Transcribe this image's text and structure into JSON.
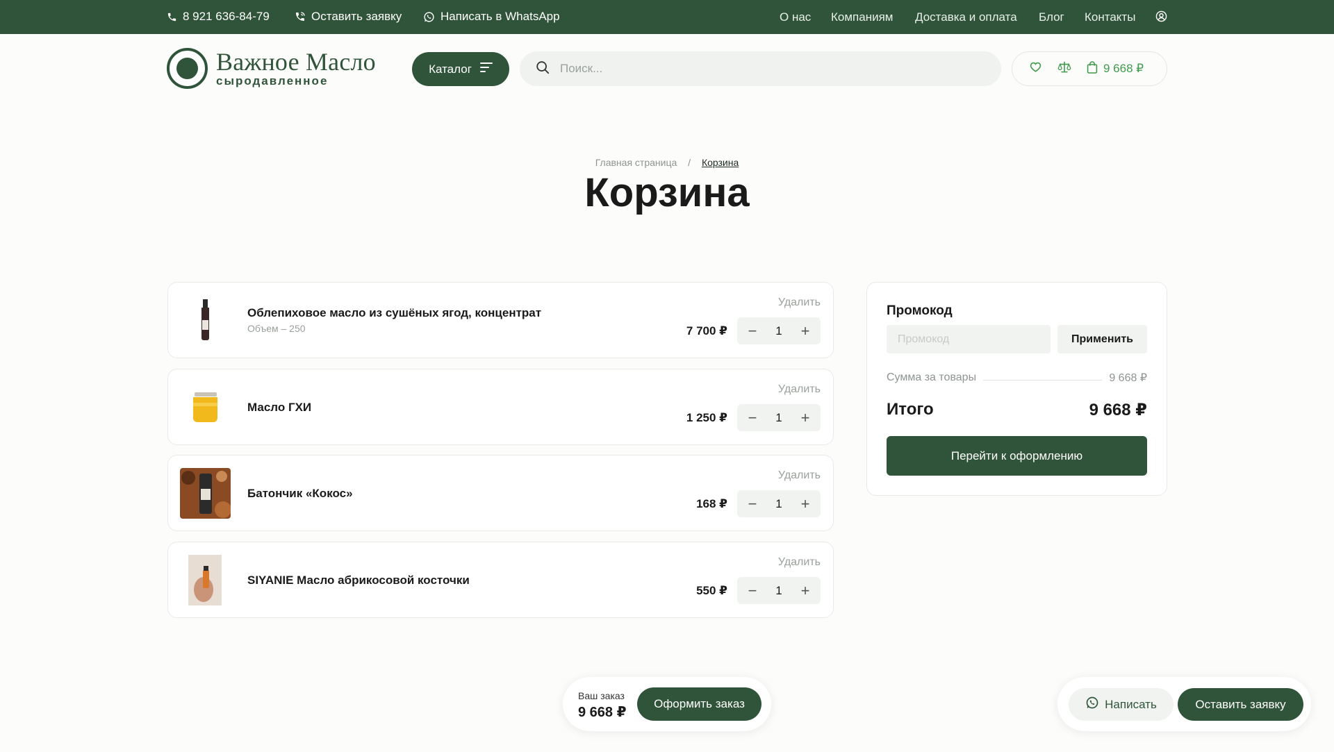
{
  "topbar": {
    "phone": "8 921 636-84-79",
    "request": "Оставить заявку",
    "whatsapp": "Написать в WhatsApp",
    "nav": [
      "О нас",
      "Компаниям",
      "Доставка и оплата",
      "Блог",
      "Контакты"
    ]
  },
  "header": {
    "logo_name": "Важное Масло",
    "logo_sub": "сыродавленное",
    "catalog": "Каталог",
    "search_placeholder": "Поиск...",
    "cart_total": "9 668 ₽"
  },
  "breadcrumb": {
    "home": "Главная страница",
    "separator": "/",
    "current": "Корзина"
  },
  "page_title": "Корзина",
  "cart": {
    "remove_label": "Удалить",
    "items": [
      {
        "title": "Облепиховое масло из сушёных ягод, концентрат",
        "meta": "Объем – 250",
        "price": "7 700 ₽",
        "qty": "1"
      },
      {
        "title": "Масло ГХИ",
        "meta": "",
        "price": "1 250 ₽",
        "qty": "1"
      },
      {
        "title": "Батончик «Кокос»",
        "meta": "",
        "price": "168 ₽",
        "qty": "1"
      },
      {
        "title": "SIYANIE Масло абрикосовой косточки",
        "meta": "",
        "price": "550 ₽",
        "qty": "1"
      }
    ]
  },
  "summary": {
    "promo_title": "Промокод",
    "promo_placeholder": "Промокод",
    "apply": "Применить",
    "subtotal_label": "Сумма за товары",
    "subtotal_value": "9 668 ₽",
    "total_label": "Итого",
    "total_value": "9 668 ₽",
    "checkout": "Перейти к оформлению"
  },
  "order_bar": {
    "label": "Ваш заказ",
    "amount": "9 668 ₽",
    "button": "Оформить заказ"
  },
  "contact_bar": {
    "write": "Написать",
    "request": "Оставить заявку"
  },
  "colors": {
    "brand": "#305439",
    "accent": "#3f9a4b"
  }
}
